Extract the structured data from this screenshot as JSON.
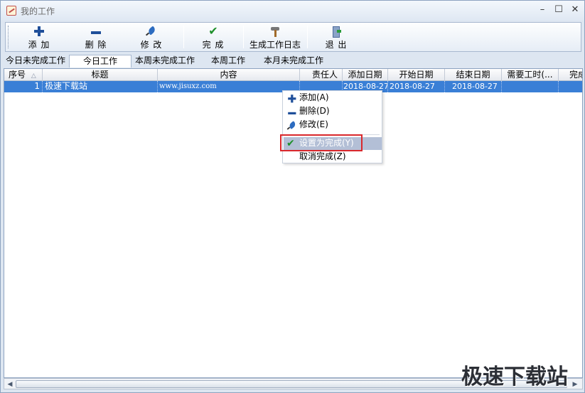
{
  "window": {
    "title": "我的工作",
    "min": "–",
    "max": "☐",
    "close": "✕"
  },
  "toolbar": {
    "buttons": [
      {
        "label": "添 加",
        "icon": "plus-icon"
      },
      {
        "label": "删 除",
        "icon": "minus-icon"
      },
      {
        "label": "修 改",
        "icon": "pen-icon"
      },
      {
        "label": "完 成",
        "icon": "check-icon"
      },
      {
        "label": "生成工作日志",
        "icon": "hammer-icon"
      },
      {
        "label": "退 出",
        "icon": "exit-icon"
      }
    ]
  },
  "tabs": [
    "今日未完成工作",
    "今日工作",
    "本周未完成工作",
    "本周工作",
    "本月未完成工作"
  ],
  "active_tab": "今日工作",
  "grid": {
    "columns": [
      "序号",
      "标题",
      "内容",
      "责任人",
      "添加日期",
      "开始日期",
      "结束日期",
      "需要工时(...",
      "完成"
    ],
    "sort_indicator": "△",
    "rows": [
      {
        "id": "1",
        "title": "极速下载站",
        "content": "www.jisuxz.com",
        "owner": "",
        "added": "2018-08-27",
        "start": "2018-08-27",
        "end": "2018-08-27",
        "hours": "",
        "done": ""
      }
    ]
  },
  "context_menu": {
    "items": [
      {
        "label": "添加(A)",
        "icon": "plus-icon"
      },
      {
        "label": "删除(D)",
        "icon": "minus-icon"
      },
      {
        "label": "修改(E)",
        "icon": "pen-icon"
      },
      {
        "label": "设置为完成(Y)",
        "icon": "check-icon",
        "highlighted": true
      },
      {
        "label": "取消完成(Z)",
        "icon": ""
      }
    ]
  },
  "watermark": "极速下载站",
  "colors": {
    "selection": "#3a7fd6",
    "menu_highlight": "#b3bfd6",
    "annotation_box": "#d9282c"
  }
}
